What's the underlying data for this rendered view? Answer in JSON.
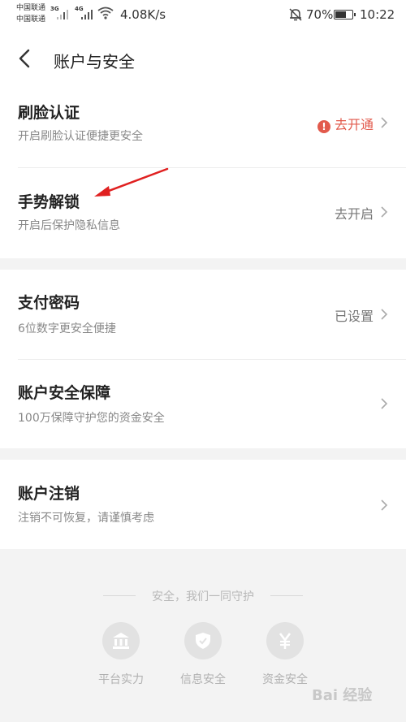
{
  "status_bar": {
    "carrier1": "中国联通",
    "carrier2": "中国联通",
    "net1": "3G",
    "net2": "4G",
    "speed": "4.08K/s",
    "battery": "70%",
    "battery_level": 0.7,
    "time": "10:22"
  },
  "header": {
    "title": "账户与安全"
  },
  "items": [
    {
      "title": "刷脸认证",
      "subtitle": "开启刷脸认证便捷更安全",
      "action": "去开通",
      "alert": true
    },
    {
      "title": "手势解锁",
      "subtitle": "开启后保护隐私信息",
      "action": "去开启"
    },
    {
      "title": "支付密码",
      "subtitle": "6位数字更安全便捷",
      "action": "已设置"
    },
    {
      "title": "账户安全保障",
      "subtitle": "100万保障守护您的资金安全",
      "action": ""
    },
    {
      "title": "账户注销",
      "subtitle": "注销不可恢复，请谨慎考虑",
      "action": ""
    }
  ],
  "footer": {
    "slogan": "安全，我们一同守护",
    "badges": [
      {
        "label": "平台实力",
        "icon": "bank-icon"
      },
      {
        "label": "信息安全",
        "icon": "shield-check-icon"
      },
      {
        "label": "资金安全",
        "icon": "yuan-icon"
      }
    ],
    "watermark": "Bai 经验"
  },
  "colors": {
    "alert": "#e25a4c",
    "annotation_arrow": "#e02020"
  }
}
